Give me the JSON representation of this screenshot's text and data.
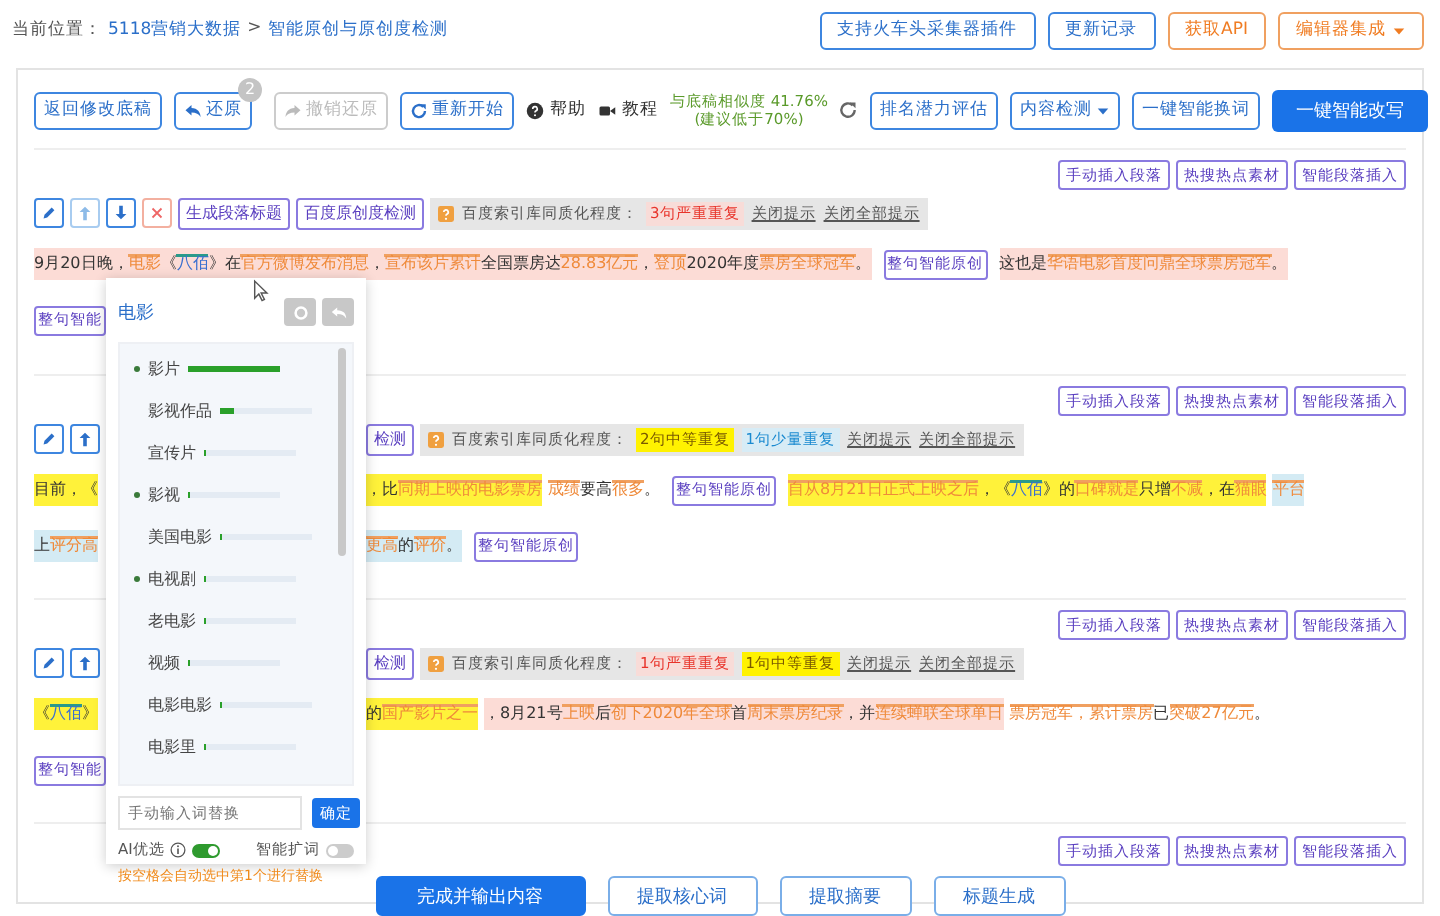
{
  "breadcrumb": {
    "label": "当前位置：",
    "links": [
      "5118营销大数据",
      "智能原创与原创度检测"
    ],
    "separator": ">"
  },
  "top_buttons": [
    {
      "text": "支持火车头采集器插件",
      "kind": "outline",
      "caret": false
    },
    {
      "text": "更新记录",
      "kind": "outline",
      "caret": false
    },
    {
      "text": "获取API",
      "kind": "accent",
      "caret": false
    },
    {
      "text": "编辑器集成",
      "kind": "accent",
      "caret": true
    }
  ],
  "toolbar": [
    {
      "kind": "button",
      "text": "返回修改底稿",
      "disabled": false,
      "caret": false
    },
    {
      "kind": "undo",
      "text": "还原",
      "disabled": false,
      "badge": "2"
    },
    {
      "kind": "redo",
      "text": "撤销还原",
      "disabled": true
    },
    {
      "kind": "restart",
      "text": "重新开始",
      "disabled": false
    },
    {
      "kind": "help",
      "text": "帮助"
    },
    {
      "kind": "tutorial",
      "text": "教程"
    },
    {
      "kind": "similarity",
      "text": "与底稿相似度 41.76%",
      "hint": "(建议低于70%)"
    },
    {
      "kind": "button",
      "text": "排名潜力评估",
      "disabled": false,
      "caret": false
    },
    {
      "kind": "button",
      "text": "内容检测",
      "disabled": false,
      "caret": true
    },
    {
      "kind": "button",
      "text": "一键智能换词",
      "disabled": false,
      "caret": false
    },
    {
      "kind": "primary",
      "text": "一键智能改写"
    }
  ],
  "paragraphs": [
    {
      "actions": [
        "手动插入段落",
        "热搜热点素材",
        "智能段落插入"
      ],
      "toolbar": {
        "before": [
          {
            "kind": "edit",
            "disabled": false
          },
          {
            "kind": "up",
            "disabled": true
          },
          {
            "kind": "down",
            "disabled": false
          },
          {
            "kind": "delete",
            "disabled": false
          },
          {
            "kind": "tool",
            "text": "生成段落标题"
          },
          {
            "kind": "tool",
            "text": "百度原创度检测"
          },
          {
            "kind": "notice",
            "label": "百度索引库同质化程度：",
            "tags": [
              {
                "text": "3句严重重复",
                "kind": "severe"
              }
            ],
            "links": [
              "关闭提示",
              "关闭全部提示"
            ]
          }
        ]
      },
      "lines": [
        {
          "before": [
            {
              "kind": "severe",
              "words": [
                {
                  "t": "9月20日晚，"
                },
                {
                  "t": "电影",
                  "replaced": true
                },
                {
                  "t": "《"
                },
                {
                  "t": "八佰",
                  "entity": true
                },
                {
                  "t": "》在"
                },
                {
                  "t": "官方微博",
                  "replaced": true
                },
                {
                  "t": "发布",
                  "replaced": true
                },
                {
                  "t": "消息",
                  "replaced": true
                },
                {
                  "t": "，"
                },
                {
                  "t": "宣布",
                  "replaced": true
                },
                {
                  "t": "该片",
                  "replaced": true
                },
                {
                  "t": "累计",
                  "replaced": true
                },
                {
                  "t": "全国票房达"
                },
                {
                  "t": "28.83亿元",
                  "replaced": true
                },
                {
                  "t": "，"
                },
                {
                  "t": "登顶",
                  "replaced": true
                },
                {
                  "t": "2020年度"
                },
                {
                  "t": "票房",
                  "replaced": true
                },
                {
                  "t": "全球",
                  "replaced": true
                },
                {
                  "t": "冠军",
                  "replaced": true
                },
                {
                  "t": "。"
                }
              ]
            },
            {
              "kind": "rewrite",
              "text": "整句智能原创"
            },
            {
              "kind": "severe",
              "words": [
                {
                  "t": "这也是"
                },
                {
                  "t": "华语电影",
                  "replaced": true
                },
                {
                  "t": "首度",
                  "replaced": true
                },
                {
                  "t": "问鼎",
                  "replaced": true
                },
                {
                  "t": "全球票房",
                  "replaced": true
                },
                {
                  "t": "冠军",
                  "replaced": true
                },
                {
                  "t": "。"
                }
              ]
            }
          ]
        },
        {
          "before": [
            {
              "kind": "rewrite",
              "text": "整句智能"
            }
          ]
        }
      ]
    },
    {
      "actions": [
        "手动插入段落",
        "热搜热点素材",
        "智能段落插入"
      ],
      "toolbar": {
        "before": [
          {
            "kind": "edit",
            "disabled": false
          },
          {
            "kind": "up",
            "disabled": false
          }
        ],
        "after": [
          {
            "kind": "tool",
            "text": "检测"
          },
          {
            "kind": "notice",
            "label": "百度索引库同质化程度：",
            "tags": [
              {
                "text": "2句中等重复",
                "kind": "medium"
              },
              {
                "text": "1句少量重复",
                "kind": "light"
              }
            ],
            "links": [
              "关闭提示",
              "关闭全部提示"
            ]
          }
        ]
      },
      "lines": [
        {
          "before": [
            {
              "kind": "medium",
              "words": [
                {
                  "t": "目前，《"
                }
              ]
            }
          ],
          "after": [
            {
              "kind": "medium",
              "words": [
                {
                  "t": "，比"
                },
                {
                  "t": "同期",
                  "replaced": true
                },
                {
                  "t": "上映的电影",
                  "replaced": true
                },
                {
                  "t": "票房",
                  "replaced": true
                }
              ]
            },
            {
              "kind": "plain",
              "words": [
                {
                  "t": "成绩",
                  "replaced": true
                },
                {
                  "t": "要高"
                },
                {
                  "t": "很多",
                  "replaced": true
                },
                {
                  "t": "。"
                }
              ]
            },
            {
              "kind": "rewrite",
              "text": "整句智能原创"
            },
            {
              "kind": "medium",
              "words": [
                {
                  "t": "自从",
                  "replaced": true
                },
                {
                  "t": "8月21日",
                  "replaced": true
                },
                {
                  "t": "正式",
                  "replaced": true
                },
                {
                  "t": "上映",
                  "replaced": true
                },
                {
                  "t": "之后",
                  "replaced": true
                },
                {
                  "t": "，《"
                },
                {
                  "t": "八佰",
                  "entity": true
                },
                {
                  "t": "》的"
                },
                {
                  "t": "口碑",
                  "replaced": true
                },
                {
                  "t": "就是",
                  "replaced": true
                },
                {
                  "t": "只增"
                },
                {
                  "t": "不减",
                  "replaced": true
                },
                {
                  "t": "，在"
                },
                {
                  "t": "猫眼",
                  "replaced": true
                }
              ]
            },
            {
              "kind": "light",
              "words": [
                {
                  "t": "平台",
                  "replaced": true
                }
              ]
            }
          ]
        },
        {
          "before": [
            {
              "kind": "light",
              "words": [
                {
                  "t": "上"
                },
                {
                  "t": "评分高",
                  "replaced": true
                }
              ]
            }
          ],
          "after": [
            {
              "kind": "light",
              "words": [
                {
                  "t": "更高",
                  "replaced": true
                },
                {
                  "t": "的"
                },
                {
                  "t": "评价",
                  "replaced": true
                },
                {
                  "t": "。"
                }
              ]
            },
            {
              "kind": "rewrite",
              "text": "整句智能原创"
            }
          ]
        }
      ]
    },
    {
      "actions": [
        "手动插入段落",
        "热搜热点素材",
        "智能段落插入"
      ],
      "toolbar": {
        "before": [
          {
            "kind": "edit",
            "disabled": false
          },
          {
            "kind": "up",
            "disabled": false
          }
        ],
        "after": [
          {
            "kind": "tool",
            "text": "检测"
          },
          {
            "kind": "notice",
            "label": "百度索引库同质化程度：",
            "tags": [
              {
                "text": "1句严重重复",
                "kind": "severe"
              },
              {
                "text": "1句中等重复",
                "kind": "medium"
              }
            ],
            "links": [
              "关闭提示",
              "关闭全部提示"
            ]
          }
        ]
      },
      "lines": [
        {
          "before": [
            {
              "kind": "medium",
              "words": [
                {
                  "t": "《"
                },
                {
                  "t": "八佰",
                  "entity": true
                },
                {
                  "t": "》"
                }
              ]
            }
          ],
          "after": [
            {
              "kind": "medium",
              "words": [
                {
                  "t": "的"
                },
                {
                  "t": "国产影片",
                  "replaced": true
                },
                {
                  "t": "之一",
                  "replaced": true
                }
              ]
            },
            {
              "kind": "severe",
              "words": [
                {
                  "t": "，8月21号"
                },
                {
                  "t": "上映",
                  "replaced": true
                },
                {
                  "t": "后"
                },
                {
                  "t": "创下",
                  "replaced": true
                },
                {
                  "t": "2020年",
                  "replaced": true
                },
                {
                  "t": "全球",
                  "replaced": true
                },
                {
                  "t": "首"
                },
                {
                  "t": "周末",
                  "replaced": true
                },
                {
                  "t": "票房",
                  "replaced": true
                },
                {
                  "t": "纪录",
                  "replaced": true
                },
                {
                  "t": "，并"
                },
                {
                  "t": "连续",
                  "replaced": true
                },
                {
                  "t": "蝉联",
                  "replaced": true
                },
                {
                  "t": "全球",
                  "replaced": true
                },
                {
                  "t": "单日",
                  "replaced": true
                }
              ]
            },
            {
              "kind": "plain",
              "words": [
                {
                  "t": "票房",
                  "replaced": true
                },
                {
                  "t": "冠军，",
                  "replaced": true
                },
                {
                  "t": "累计",
                  "replaced": true
                },
                {
                  "t": "票房",
                  "replaced": true
                },
                {
                  "t": "已"
                },
                {
                  "t": "突破",
                  "replaced": true
                },
                {
                  "t": "27亿元",
                  "replaced": true
                },
                {
                  "t": "。"
                }
              ]
            }
          ]
        },
        {
          "before": [
            {
              "kind": "rewrite",
              "text": "整句智能"
            }
          ]
        }
      ]
    }
  ],
  "final_actions": [
    "手动插入段落",
    "热搜热点素材",
    "智能段落插入"
  ],
  "bottom_buttons": [
    {
      "text": "完成并输出内容",
      "primary": true
    },
    {
      "text": "提取核心词",
      "primary": false
    },
    {
      "text": "提取摘要",
      "primary": false
    },
    {
      "text": "标题生成",
      "primary": false
    }
  ],
  "word_popup": {
    "title": "电影",
    "candidates": [
      {
        "text": "影片",
        "dot": true,
        "level": 1
      },
      {
        "text": "影视作品",
        "dot": false,
        "level": 0.15
      },
      {
        "text": "宣传片",
        "dot": false,
        "level": 0.03
      },
      {
        "text": "影视",
        "dot": true,
        "level": 0.03
      },
      {
        "text": "美国电影",
        "dot": false,
        "level": 0.03
      },
      {
        "text": "电视剧",
        "dot": true,
        "level": 0.03
      },
      {
        "text": "老电影",
        "dot": false,
        "level": 0.03
      },
      {
        "text": "视频",
        "dot": false,
        "level": 0.03
      },
      {
        "text": "电影电影",
        "dot": false,
        "level": 0.03
      },
      {
        "text": "电影里",
        "dot": false,
        "level": 0.03
      }
    ],
    "input": {
      "placeholder": "手动输入词替换",
      "button": "确定"
    },
    "options": [
      {
        "label": "AI优选",
        "info": true,
        "on": true
      },
      {
        "label": "智能扩词",
        "info": false,
        "on": false
      }
    ],
    "hint": "按空格会自动选中第1个进行替换"
  }
}
